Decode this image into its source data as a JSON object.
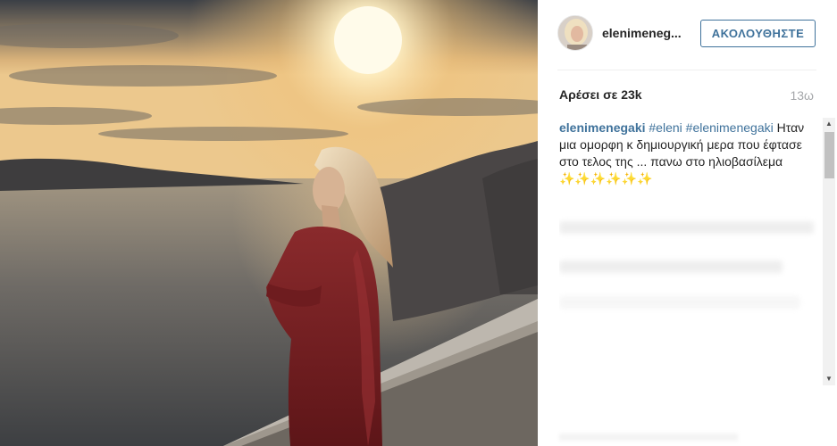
{
  "post": {
    "username": "elenimenegaki",
    "username_display": "elenimeneg...",
    "follow_label": "ΑΚΟΛΟΥΘΗΣΤΕ",
    "likes": "Αρέσει σε 23k",
    "time": "13ω"
  },
  "caption": {
    "author": "elenimenegaki",
    "tags": [
      "#eleni",
      "#elenimenegaki"
    ],
    "text": "Ηταν μια ομορφη κ δημιουργική μερα που έφτασε στο τελος της ... πανω στο ηλιοβασίλεμα ✨✨✨✨✨✨"
  },
  "photo": {
    "subject": "woman-in-red-dress-at-sunset",
    "colors": {
      "sky_top": "#3a3e44",
      "sun": "#fff6d8",
      "glow": "#e8b766",
      "sea": "#6b6a68",
      "dress": "#7a1e22"
    }
  },
  "colors": {
    "accent": "#3f729b",
    "text": "#262626",
    "muted": "#a5a7aa"
  },
  "icons": [
    "avatar",
    "scroll-up-arrow-icon",
    "scroll-down-arrow-icon"
  ]
}
